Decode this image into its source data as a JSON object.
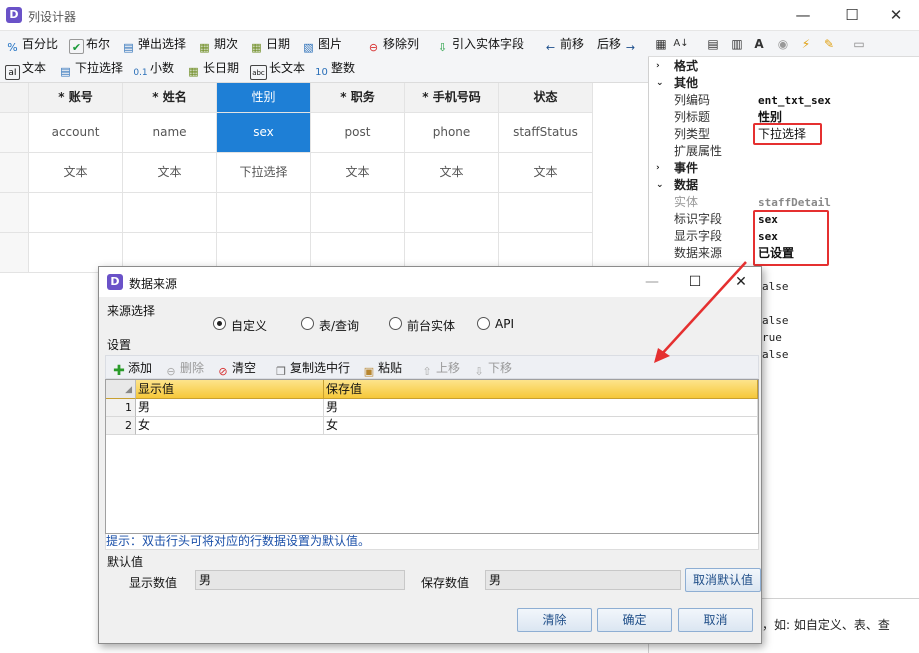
{
  "window": {
    "title": "列设计器",
    "icon_letter": "D",
    "minimize": "—",
    "maximize": "☐",
    "close": "✕"
  },
  "toolbar": {
    "row1": [
      "百分比",
      "布尔",
      "弹出选择",
      "期次",
      "日期",
      "图片",
      "移除列",
      "引入实体字段",
      "前移",
      "后移"
    ],
    "row2": [
      "文本",
      "下拉选择",
      "小数",
      "长日期",
      "长文本",
      "整数"
    ],
    "icons": {
      "percent": "%",
      "bool": "✔",
      "popup": "▤",
      "period": "▦",
      "date": "▦",
      "image": "▧",
      "remove": "⊖",
      "import": "⇩",
      "prev": "←",
      "next": "→",
      "text": "aI",
      "dropdown": "▤",
      "decimal": "0.1",
      "longdate": "▦",
      "longtext": "abc",
      "integer": "10"
    }
  },
  "grid": {
    "columns": [
      {
        "header": "* 账号",
        "field": "account",
        "type": "文本"
      },
      {
        "header": "* 姓名",
        "field": "name",
        "type": "文本"
      },
      {
        "header": "性别",
        "field": "sex",
        "type": "下拉选择"
      },
      {
        "header": "* 职务",
        "field": "post",
        "type": "文本"
      },
      {
        "header": "* 手机号码",
        "field": "phone",
        "type": "文本"
      },
      {
        "header": "状态",
        "field": "staffStatus",
        "type": "文本"
      }
    ]
  },
  "props": {
    "sections": {
      "format": "格式",
      "other": "其他",
      "event": "事件",
      "data": "数据"
    },
    "rows": {
      "col_code": {
        "key": "列编码",
        "value": "ent_txt_sex"
      },
      "col_title": {
        "key": "列标题",
        "value": "性别"
      },
      "col_type": {
        "key": "列类型",
        "value": "下拉选择"
      },
      "ext_attr": {
        "key": "扩展属性",
        "value": ""
      },
      "entity": {
        "key": "实体",
        "value": "staffDetail"
      },
      "id_field": {
        "key": "标识字段",
        "value": "sex"
      },
      "display_field": {
        "key": "显示字段",
        "value": "sex"
      },
      "data_source": {
        "key": "数据来源",
        "value": "已设置"
      }
    },
    "partial_values": [
      "alse",
      "alse",
      "rue",
      "alse"
    ],
    "description": "，如: 如自定义、表、查"
  },
  "dialog": {
    "title": "数据来源",
    "source_label": "来源选择",
    "radios": [
      "自定义",
      "表/查询",
      "前台实体",
      "API"
    ],
    "selected_radio": "自定义",
    "settings_label": "设置",
    "toolbar": [
      "添加",
      "删除",
      "清空",
      "复制选中行",
      "粘贴",
      "上移",
      "下移"
    ],
    "table": {
      "headers": [
        "显示值",
        "保存值"
      ],
      "rows": [
        {
          "num": "1",
          "display": "男",
          "save": "男"
        },
        {
          "num": "2",
          "display": "女",
          "save": "女"
        }
      ]
    },
    "hint": "提示：双击行头可将对应的行数据设置为默认值。",
    "default_label": "默认值",
    "default_display_label": "显示数值",
    "default_display_value": "男",
    "default_save_label": "保存数值",
    "default_save_value": "男",
    "cancel_default": "取消默认值",
    "buttons": {
      "clear": "清除",
      "ok": "确定",
      "cancel": "取消"
    }
  },
  "colors": {
    "selected_col": "#1e7fd6",
    "highlight": "#e53030",
    "grid_header": "#f6c83a",
    "app_icon": "#6a52c8"
  }
}
